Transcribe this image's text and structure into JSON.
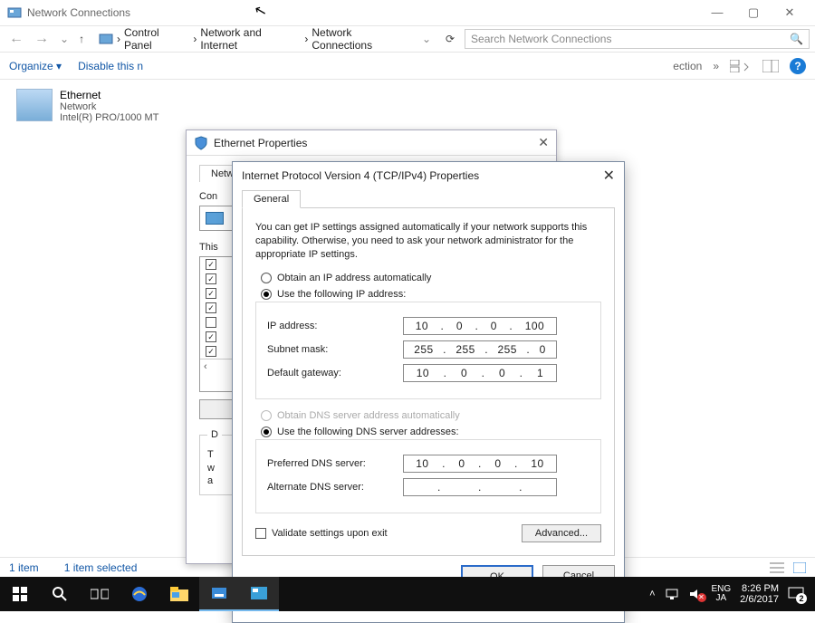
{
  "window": {
    "title": "Network Connections",
    "min": "—",
    "max": "▢",
    "close": "✕"
  },
  "nav": {
    "back": "←",
    "forward": "→",
    "up": "↑",
    "breadcrumb": [
      "Control Panel",
      "Network and Internet",
      "Network Connections"
    ],
    "sep": "›",
    "dropdown": "⌄",
    "refresh": "⟳",
    "search_placeholder": "Search Network Connections",
    "search_icon": "🔍"
  },
  "toolbar": {
    "organize": "Organize ▾",
    "disable": "Disable this n",
    "connection_trunc": "ection",
    "more": "»"
  },
  "adapter": {
    "name": "Ethernet",
    "type": "Network",
    "device": "Intel(R) PRO/1000 MT"
  },
  "eth_dlg": {
    "title": "Ethernet Properties",
    "close": "✕",
    "tab_networking": "Netwo",
    "connect_using_label": "Con",
    "items_label": "This",
    "items": [
      {
        "checked": true
      },
      {
        "checked": true
      },
      {
        "checked": true
      },
      {
        "checked": true
      },
      {
        "checked": false
      },
      {
        "checked": true
      },
      {
        "checked": true
      }
    ],
    "desc_label": "D",
    "desc_t": "T",
    "desc_w": "w",
    "desc_a": "a"
  },
  "ip_dlg": {
    "title": "Internet Protocol Version 4 (TCP/IPv4) Properties",
    "close": "✕",
    "tab_general": "General",
    "intro": "You can get IP settings assigned automatically if your network supports this capability. Otherwise, you need to ask your network administrator for the appropriate IP settings.",
    "radio_auto_ip": "Obtain an IP address automatically",
    "radio_manual_ip": "Use the following IP address:",
    "lbl_ip": "IP address:",
    "lbl_subnet": "Subnet mask:",
    "lbl_gateway": "Default gateway:",
    "ip": [
      "10",
      "0",
      "0",
      "100"
    ],
    "subnet": [
      "255",
      "255",
      "255",
      "0"
    ],
    "gateway": [
      "10",
      "0",
      "0",
      "1"
    ],
    "radio_auto_dns": "Obtain DNS server address automatically",
    "radio_manual_dns": "Use the following DNS server addresses:",
    "lbl_pref_dns": "Preferred DNS server:",
    "lbl_alt_dns": "Alternate DNS server:",
    "pref_dns": [
      "10",
      "0",
      "0",
      "10"
    ],
    "alt_dns": [
      "",
      "",
      "",
      ""
    ],
    "validate": "Validate settings upon exit",
    "advanced": "Advanced...",
    "ok": "OK",
    "cancel": "Cancel"
  },
  "status": {
    "count": "1 item",
    "selected": "1 item selected"
  },
  "taskbar": {
    "lang1": "ENG",
    "lang2": "JA",
    "time": "8:26 PM",
    "date": "2/6/2017",
    "notif_count": "2"
  }
}
